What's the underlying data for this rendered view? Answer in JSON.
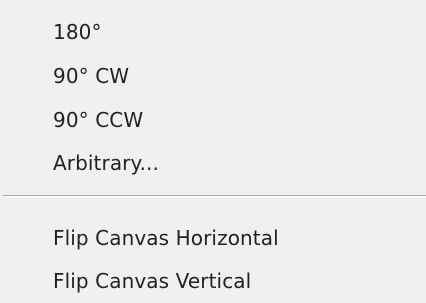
{
  "menu": {
    "items": [
      {
        "label": "180°"
      },
      {
        "label": "90° CW"
      },
      {
        "label": "90° CCW"
      },
      {
        "label": "Arbitrary..."
      }
    ],
    "items_after_separator": [
      {
        "label": "Flip Canvas Horizontal"
      },
      {
        "label": "Flip Canvas Vertical"
      }
    ]
  }
}
